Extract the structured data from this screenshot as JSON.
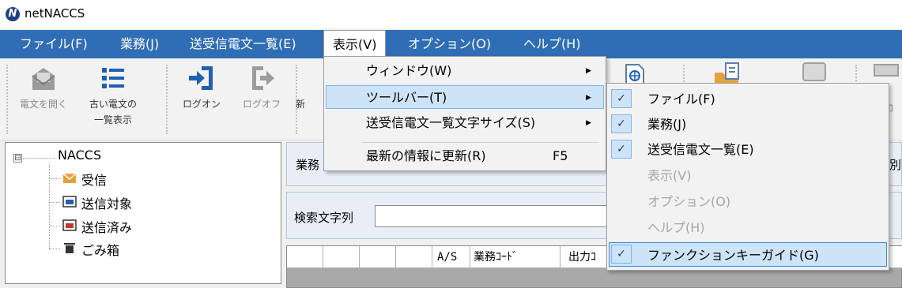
{
  "window": {
    "title": "netNACCS",
    "logo_letter": "N"
  },
  "menubar": {
    "items": [
      {
        "label": "ファイル(F)"
      },
      {
        "label": "業務(J)"
      },
      {
        "label": "送受信電文一覧(E)"
      },
      {
        "label": "表示(V)",
        "active": true
      },
      {
        "label": "オプション(O)"
      },
      {
        "label": "ヘルプ(H)"
      }
    ]
  },
  "toolbar": {
    "open_message": "電文を開く",
    "old_message_line1": "古い電文の",
    "old_message_line2": "一覧表示",
    "logon": "ログオン",
    "logoff": "ログオフ",
    "new_partial": "新",
    "print_partial": "印"
  },
  "tree": {
    "root": "NACCS",
    "expander": "⊟",
    "items": [
      {
        "label": "受信",
        "icon": "inbox-icon"
      },
      {
        "label": "送信対象",
        "icon": "outbox-icon"
      },
      {
        "label": "送信済み",
        "icon": "sent-icon"
      },
      {
        "label": "ごみ箱",
        "icon": "trash-icon"
      }
    ]
  },
  "filter_panel": {
    "label_partial": "業務",
    "right_partial": "別"
  },
  "search_panel": {
    "label": "検索文字列",
    "value": ""
  },
  "grid": {
    "columns": [
      "",
      "",
      "",
      "",
      "A/S",
      "業務ｺｰﾄﾞ",
      "出力ｺ"
    ]
  },
  "view_menu": {
    "items": [
      {
        "label": "ウィンドウ(W)",
        "has_submenu": true
      },
      {
        "label": "ツールバー(T)",
        "has_submenu": true,
        "highlighted": true
      },
      {
        "label": "送受信電文一覧文字サイズ(S)",
        "has_submenu": true
      },
      {
        "label": "最新の情報に更新(R)",
        "shortcut": "F5"
      }
    ],
    "submenu_arrow": "▶"
  },
  "toolbar_submenu": {
    "check_glyph": "✓",
    "items": [
      {
        "label": "ファイル(F)",
        "checked": true,
        "enabled": true
      },
      {
        "label": "業務(J)",
        "checked": true,
        "enabled": true
      },
      {
        "label": "送受信電文一覧(E)",
        "checked": true,
        "enabled": true
      },
      {
        "label": "表示(V)",
        "checked": false,
        "enabled": false
      },
      {
        "label": "オプション(O)",
        "checked": false,
        "enabled": false
      },
      {
        "label": "ヘルプ(H)",
        "checked": false,
        "enabled": false
      },
      {
        "label": "ファンクションキーガイド(G)",
        "checked": true,
        "enabled": true,
        "highlighted": true
      }
    ]
  },
  "colors": {
    "menubar_bg": "#2f6db5",
    "highlight_bg": "#cde3f7",
    "highlight_border": "#3c89d7",
    "inbox_orange": "#e8a13a",
    "outbox_blue": "#1f5fb4",
    "toolbar_icon_blue": "#1f5fb4"
  }
}
